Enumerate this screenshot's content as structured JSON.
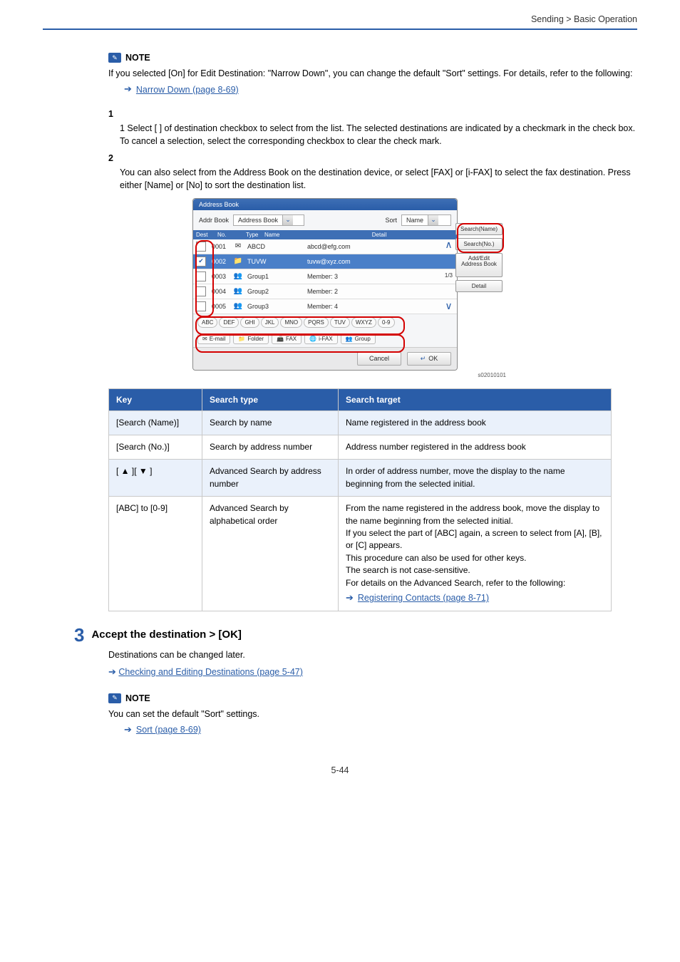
{
  "header_right": "Sending > Basic Operation",
  "note_label": "NOTE",
  "notes_top": [
    "If you selected [On] for Edit Destination: \"Narrow Down\", you can change the default \"Sort\" settings. For details, refer to the following:"
  ],
  "ref_narrow_down": "Narrow Down (page 8-69)",
  "step1": "1 Select [ ] of destination checkbox to select from the list. The selected destinations are indicated by a checkmark in the check box. To cancel a selection, select the corresponding checkbox to clear the check mark.",
  "step2": "You can also select from the Address Book on the destination device, or select [FAX] or [i-FAX] to select the fax destination. Press either [Name] or [No] to sort the destination list.",
  "addr": {
    "title": "Address Book",
    "addr_book_label": "Addr Book",
    "addr_book_value": "Address Book",
    "sort_label": "Sort",
    "sort_value": "Name",
    "headers": {
      "dest": "Dest",
      "no": "No.",
      "type": "Type",
      "name": "Name",
      "detail": "Detail"
    },
    "rows": [
      {
        "no": "0001",
        "icon": "✉",
        "name": "ABCD",
        "detail": "abcd@efg.com",
        "checked": false,
        "sel": false
      },
      {
        "no": "0002",
        "icon": "📁",
        "name": "TUVW",
        "detail": "tuvw@xyz.com",
        "checked": true,
        "sel": true
      },
      {
        "no": "0003",
        "icon": "👥",
        "name": "Group1",
        "detail": "Member:     3",
        "checked": false,
        "sel": false
      },
      {
        "no": "0004",
        "icon": "👥",
        "name": "Group2",
        "detail": "Member:     2",
        "checked": false,
        "sel": false
      },
      {
        "no": "0005",
        "icon": "👥",
        "name": "Group3",
        "detail": "Member:     4",
        "checked": false,
        "sel": false
      }
    ],
    "alpha": [
      "ABC",
      "DEF",
      "GHI",
      "JKL",
      "MNO",
      "PQRS",
      "TUV",
      "WXYZ",
      "0-9"
    ],
    "dest_tabs": [
      "E-mail",
      "Folder",
      "FAX",
      "i-FAX",
      "Group"
    ],
    "right_buttons": [
      "Search(Name)",
      "Search(No.)",
      "Add/Edit Address Book",
      "Detail"
    ],
    "page_indicator": "1/3",
    "cancel": "Cancel",
    "ok": "OK",
    "figref": "s02010101"
  },
  "table": {
    "headers": {
      "key": "Key",
      "search": "Search type",
      "search_target": "Search target"
    },
    "rows": [
      {
        "key": "[Search (Name)]",
        "search": "Search by name",
        "detail": "Name registered in the address book"
      },
      {
        "key": "[Search (No.)]",
        "search": "Search by address number",
        "detail": "Address number registered in the address book"
      },
      {
        "key": "[ ▲ ][ ▼ ]",
        "search": "Advanced Search by address number",
        "detail": "In order of address number, move the display to the name beginning from the selected initial."
      }
    ],
    "last_key": "[ABC] to [0-9]",
    "last_search": "Advanced Search by alphabetical order",
    "last_detail": "From the name registered in the address book, move the display to the name beginning from the selected initial.",
    "last_note_1": "If you select the part of [ABC] again, a screen to select from [A], [B], or [C] appears.",
    "last_note_2": "This procedure can also be used for other keys.",
    "last_note_3": "The search is not case-sensitive.",
    "last_note_4": "For details on the Advanced Search, refer to the following:",
    "last_ref": "Registering Contacts (page 8-71)"
  },
  "big3_title": "Accept the destination > [OK]",
  "after3_body": "Destinations can be changed later.",
  "after3_ref": "Checking and Editing Destinations (page 5-47)",
  "note2_lines": "You can set the default \"Sort\" settings.",
  "note2_ref": "Sort (page 8-69)",
  "page_num": "5-44"
}
